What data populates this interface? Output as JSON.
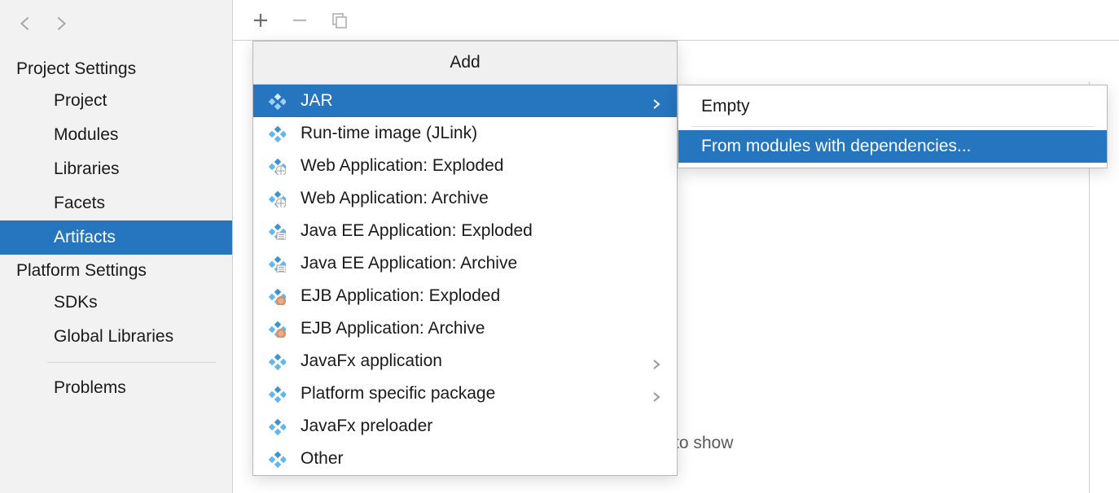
{
  "sidebar": {
    "sections": [
      {
        "header": "Project Settings",
        "items": [
          {
            "label": "Project",
            "selected": false
          },
          {
            "label": "Modules",
            "selected": false
          },
          {
            "label": "Libraries",
            "selected": false
          },
          {
            "label": "Facets",
            "selected": false
          },
          {
            "label": "Artifacts",
            "selected": true
          }
        ]
      },
      {
        "header": "Platform Settings",
        "items": [
          {
            "label": "SDKs",
            "selected": false
          },
          {
            "label": "Global Libraries",
            "selected": false
          }
        ]
      }
    ],
    "problems_label": "Problems"
  },
  "toolbar": {
    "add": "+",
    "remove": "−",
    "copy": "copy"
  },
  "main": {
    "nothing_text": "to show"
  },
  "popup": {
    "title": "Add",
    "items": [
      {
        "label": "JAR",
        "has_submenu": true,
        "highlighted": true,
        "icon": "artifact"
      },
      {
        "label": "Run-time image (JLink)",
        "has_submenu": false,
        "highlighted": false,
        "icon": "artifact"
      },
      {
        "label": "Web Application: Exploded",
        "has_submenu": false,
        "highlighted": false,
        "icon": "web"
      },
      {
        "label": "Web Application: Archive",
        "has_submenu": false,
        "highlighted": false,
        "icon": "web"
      },
      {
        "label": "Java EE Application: Exploded",
        "has_submenu": false,
        "highlighted": false,
        "icon": "ee"
      },
      {
        "label": "Java EE Application: Archive",
        "has_submenu": false,
        "highlighted": false,
        "icon": "ee"
      },
      {
        "label": "EJB Application: Exploded",
        "has_submenu": false,
        "highlighted": false,
        "icon": "ejb"
      },
      {
        "label": "EJB Application: Archive",
        "has_submenu": false,
        "highlighted": false,
        "icon": "ejb"
      },
      {
        "label": "JavaFx application",
        "has_submenu": true,
        "highlighted": false,
        "icon": "artifact"
      },
      {
        "label": "Platform specific package",
        "has_submenu": true,
        "highlighted": false,
        "icon": "artifact"
      },
      {
        "label": "JavaFx preloader",
        "has_submenu": false,
        "highlighted": false,
        "icon": "artifact"
      },
      {
        "label": "Other",
        "has_submenu": false,
        "highlighted": false,
        "icon": "artifact"
      }
    ]
  },
  "submenu": {
    "items": [
      {
        "label": "Empty",
        "highlighted": false
      },
      {
        "label": "From modules with dependencies...",
        "highlighted": true
      }
    ]
  },
  "colors": {
    "accent": "#2675BF",
    "sidebar_bg": "#F2F2F2",
    "border": "#D1D1D1"
  }
}
